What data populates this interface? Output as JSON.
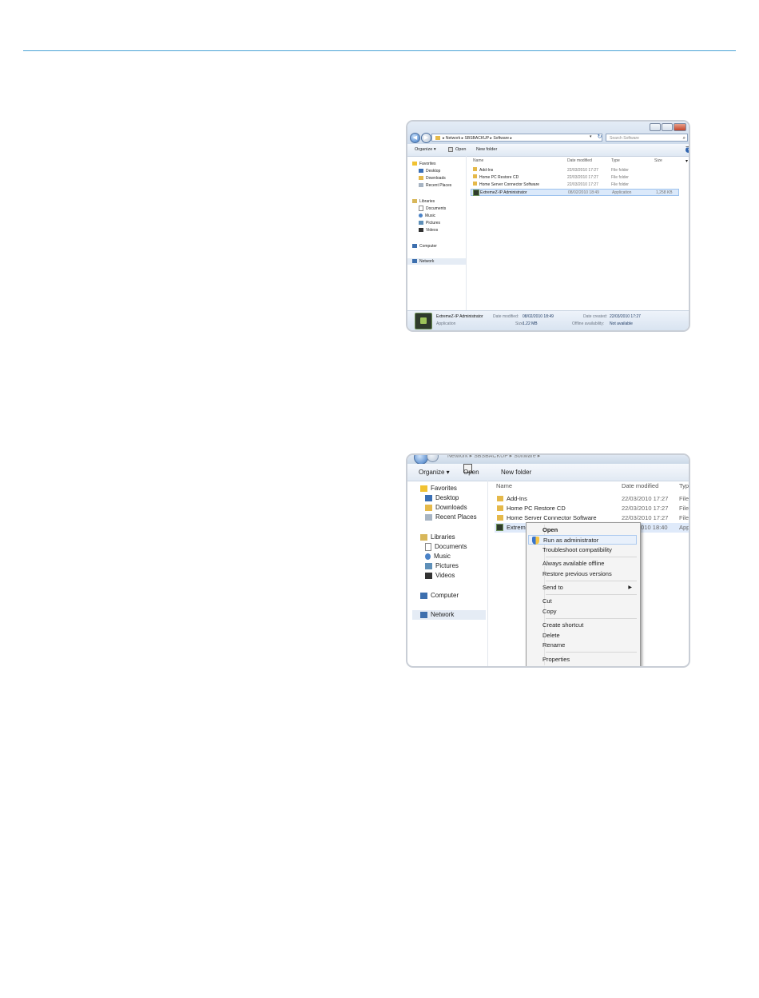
{
  "colors": {
    "rule": "#4aa3d6",
    "folder": "#e5b94a",
    "selection": "#dbe9fa"
  },
  "shot1": {
    "address": {
      "segments": [
        "Network",
        "SBSBACKUP",
        "Software"
      ]
    },
    "search_placeholder": "Search Software",
    "toolbar": {
      "organize": "Organize ▾",
      "open": "Open",
      "new_folder": "New folder"
    },
    "nav": {
      "favorites": "Favorites",
      "desktop": "Desktop",
      "downloads": "Downloads",
      "recent": "Recent Places",
      "libraries": "Libraries",
      "documents": "Documents",
      "music": "Music",
      "pictures": "Pictures",
      "videos": "Videos",
      "computer": "Computer",
      "network": "Network"
    },
    "columns": {
      "name": "Name",
      "date": "Date modified",
      "type": "Type",
      "size": "Size"
    },
    "rows": [
      {
        "name": "Add-Ins",
        "date": "22/03/2010 17:27",
        "type": "File folder",
        "size": ""
      },
      {
        "name": "Home PC Restore CD",
        "date": "22/03/2010 17:27",
        "type": "File folder",
        "size": ""
      },
      {
        "name": "Home Server Connector Software",
        "date": "22/03/2010 17:27",
        "type": "File folder",
        "size": ""
      },
      {
        "name": "ExtremeZ-IP Administrator",
        "date": "08/02/2010 18:49",
        "type": "Application",
        "size": "1,258 KB"
      }
    ],
    "details": {
      "name": "ExtremeZ-IP Administrator",
      "kind": "Application",
      "date_modified_label": "Date modified:",
      "date_modified": "08/02/2010 18:49",
      "size_label": "Size:",
      "size": "1.22 MB",
      "date_created_label": "Date created:",
      "date_created": "22/03/2010 17:27",
      "offline_label": "Offline availability:",
      "offline": "Not available"
    }
  },
  "shot2": {
    "path": "Network ▸ SBSBACKUP ▸ Software ▸",
    "toolbar": {
      "organize": "Organize ▾",
      "open": "Open",
      "new_folder": "New folder"
    },
    "nav": {
      "favorites": "Favorites",
      "desktop": "Desktop",
      "downloads": "Downloads",
      "recent": "Recent Places",
      "libraries": "Libraries",
      "documents": "Documents",
      "music": "Music",
      "pictures": "Pictures",
      "videos": "Videos",
      "computer": "Computer",
      "network": "Network"
    },
    "columns": {
      "name": "Name",
      "date": "Date modified",
      "type": "Typ"
    },
    "rows": [
      {
        "name": "Add-Ins",
        "date": "22/03/2010 17:27",
        "type": "File f"
      },
      {
        "name": "Home PC Restore CD",
        "date": "22/03/2010 17:27",
        "type": "File f"
      },
      {
        "name": "Home Server Connector Software",
        "date": "22/03/2010 17:27",
        "type": "File f"
      },
      {
        "name": "Extreme",
        "date": "2010 18:40",
        "type": "App"
      }
    ],
    "context_menu": {
      "open": "Open",
      "run_as_admin": "Run as administrator",
      "troubleshoot": "Troubleshoot compatibility",
      "always_offline": "Always available offline",
      "restore_versions": "Restore previous versions",
      "send_to": "Send to",
      "cut": "Cut",
      "copy": "Copy",
      "create_shortcut": "Create shortcut",
      "delete": "Delete",
      "rename": "Rename",
      "properties": "Properties"
    }
  }
}
